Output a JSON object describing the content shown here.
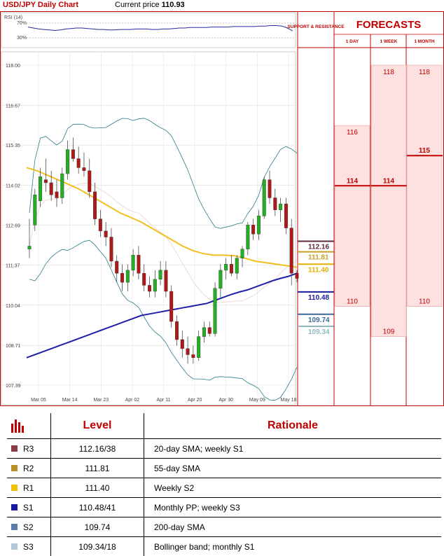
{
  "header": {
    "pair_title": "USD/JPY Daily Chart",
    "price_label": "Current price",
    "price_value": "110.93"
  },
  "chart_data": {
    "type": "candlestick",
    "title": "USD/JPY Daily Chart",
    "rsi": {
      "label": "RSI (14)",
      "levels": [
        "70%",
        "30%"
      ],
      "values": [
        62,
        60,
        58,
        57,
        56,
        55,
        56,
        58,
        59,
        60,
        60,
        59,
        58,
        57,
        57,
        56,
        56,
        57,
        57,
        57,
        58,
        58,
        58,
        57,
        57,
        58,
        58,
        59,
        60,
        60,
        61,
        61,
        61,
        61,
        62,
        62,
        62,
        62,
        63,
        63,
        63,
        63,
        63,
        64,
        64,
        65,
        65,
        64,
        60,
        54
      ]
    },
    "y_ticks": [
      "118.00",
      "116.67",
      "115.35",
      "114.02",
      "112.69",
      "111.37",
      "110.04",
      "108.71",
      "107.39"
    ],
    "ylim": [
      107.39,
      118.0
    ],
    "x_ticks": [
      "Mar 05",
      "Mar 14",
      "Mar 23",
      "Apr 02",
      "Apr 11",
      "Apr 20",
      "Apr 30",
      "May 09",
      "May 18"
    ],
    "candles": [
      {
        "o": 111.9,
        "h": 112.9,
        "l": 111.6,
        "c": 112.0
      },
      {
        "o": 112.7,
        "h": 113.9,
        "l": 112.5,
        "c": 113.7
      },
      {
        "o": 113.5,
        "h": 114.6,
        "l": 113.3,
        "c": 114.3
      },
      {
        "o": 114.2,
        "h": 114.9,
        "l": 113.8,
        "c": 114.1
      },
      {
        "o": 114.1,
        "h": 114.5,
        "l": 113.5,
        "c": 113.7
      },
      {
        "o": 113.8,
        "h": 114.2,
        "l": 113.3,
        "c": 113.6
      },
      {
        "o": 113.6,
        "h": 114.6,
        "l": 113.4,
        "c": 114.4
      },
      {
        "o": 114.4,
        "h": 115.5,
        "l": 114.2,
        "c": 115.2
      },
      {
        "o": 115.2,
        "h": 115.6,
        "l": 114.8,
        "c": 114.9
      },
      {
        "o": 114.9,
        "h": 115.3,
        "l": 114.4,
        "c": 114.6
      },
      {
        "o": 114.6,
        "h": 115.1,
        "l": 114.3,
        "c": 114.5
      },
      {
        "o": 114.5,
        "h": 114.9,
        "l": 113.6,
        "c": 113.8
      },
      {
        "o": 113.8,
        "h": 114.1,
        "l": 112.7,
        "c": 112.9
      },
      {
        "o": 112.9,
        "h": 113.2,
        "l": 112.3,
        "c": 112.5
      },
      {
        "o": 112.5,
        "h": 112.8,
        "l": 112.0,
        "c": 112.3
      },
      {
        "o": 112.3,
        "h": 112.6,
        "l": 111.3,
        "c": 111.5
      },
      {
        "o": 111.5,
        "h": 111.7,
        "l": 110.8,
        "c": 111.1
      },
      {
        "o": 111.1,
        "h": 111.4,
        "l": 110.5,
        "c": 110.8
      },
      {
        "o": 110.8,
        "h": 111.4,
        "l": 110.5,
        "c": 111.2
      },
      {
        "o": 111.2,
        "h": 111.9,
        "l": 111.0,
        "c": 111.7
      },
      {
        "o": 111.7,
        "h": 112.0,
        "l": 110.9,
        "c": 111.1
      },
      {
        "o": 111.1,
        "h": 111.4,
        "l": 110.5,
        "c": 110.7
      },
      {
        "o": 110.7,
        "h": 111.0,
        "l": 110.3,
        "c": 110.5
      },
      {
        "o": 110.5,
        "h": 111.2,
        "l": 110.3,
        "c": 110.9
      },
      {
        "o": 110.9,
        "h": 111.5,
        "l": 110.7,
        "c": 111.2
      },
      {
        "o": 111.2,
        "h": 111.5,
        "l": 110.3,
        "c": 110.5
      },
      {
        "o": 110.5,
        "h": 110.7,
        "l": 109.3,
        "c": 109.5
      },
      {
        "o": 109.5,
        "h": 109.7,
        "l": 108.7,
        "c": 108.9
      },
      {
        "o": 108.9,
        "h": 109.2,
        "l": 108.3,
        "c": 108.6
      },
      {
        "o": 108.6,
        "h": 109.0,
        "l": 108.1,
        "c": 108.4
      },
      {
        "o": 108.4,
        "h": 108.7,
        "l": 108.1,
        "c": 108.3
      },
      {
        "o": 108.3,
        "h": 109.2,
        "l": 108.2,
        "c": 109.0
      },
      {
        "o": 109.0,
        "h": 109.5,
        "l": 108.8,
        "c": 109.3
      },
      {
        "o": 109.3,
        "h": 109.5,
        "l": 109.0,
        "c": 109.1
      },
      {
        "o": 109.1,
        "h": 110.8,
        "l": 109.0,
        "c": 110.6
      },
      {
        "o": 110.6,
        "h": 111.4,
        "l": 110.3,
        "c": 111.2
      },
      {
        "o": 111.2,
        "h": 111.6,
        "l": 110.9,
        "c": 111.4
      },
      {
        "o": 111.4,
        "h": 111.7,
        "l": 111.0,
        "c": 111.1
      },
      {
        "o": 111.1,
        "h": 111.7,
        "l": 110.9,
        "c": 111.6
      },
      {
        "o": 111.6,
        "h": 112.0,
        "l": 111.3,
        "c": 111.9
      },
      {
        "o": 111.9,
        "h": 112.8,
        "l": 111.7,
        "c": 112.7
      },
      {
        "o": 112.7,
        "h": 112.9,
        "l": 112.2,
        "c": 112.4
      },
      {
        "o": 112.4,
        "h": 113.2,
        "l": 112.2,
        "c": 113.0
      },
      {
        "o": 113.0,
        "h": 114.3,
        "l": 112.9,
        "c": 114.2
      },
      {
        "o": 114.2,
        "h": 114.5,
        "l": 113.4,
        "c": 113.6
      },
      {
        "o": 113.6,
        "h": 113.9,
        "l": 113.0,
        "c": 113.2
      },
      {
        "o": 113.2,
        "h": 113.6,
        "l": 112.8,
        "c": 113.4
      },
      {
        "o": 113.4,
        "h": 113.6,
        "l": 112.4,
        "c": 112.6
      },
      {
        "o": 112.6,
        "h": 112.9,
        "l": 110.7,
        "c": 111.1
      },
      {
        "o": 111.1,
        "h": 111.2,
        "l": 110.8,
        "c": 110.93
      }
    ],
    "sma200": [
      108.3,
      108.4,
      108.5,
      108.6,
      108.7,
      108.8,
      108.9,
      109.0,
      109.1,
      109.2,
      109.3,
      109.4,
      109.5,
      109.6,
      109.7,
      109.75,
      109.8,
      109.85,
      109.9,
      109.95,
      110.0,
      110.05,
      110.1,
      110.2,
      110.3,
      110.4,
      110.48,
      110.55,
      110.65,
      110.75,
      110.85,
      110.93,
      111.0,
      111.1
    ],
    "sma55": [
      114.6,
      114.5,
      114.35,
      114.2,
      114.05,
      113.9,
      113.7,
      113.5,
      113.3,
      113.1,
      112.95,
      112.8,
      112.6,
      112.4,
      112.2,
      112.0,
      111.85,
      111.75,
      111.7,
      111.7,
      111.68,
      111.6,
      111.5,
      111.45,
      111.4,
      111.35,
      111.3
    ],
    "forecast": {
      "columns": [
        "1 DAY",
        "1 WEEK",
        "1 MONTH"
      ],
      "header": "FORECASTS",
      "support_resistance_label": "SUPPORT & RESISTANCE",
      "one_day": {
        "high": "116",
        "mid": "114",
        "low": "110"
      },
      "one_week": {
        "high": "118",
        "mid": "114",
        "low": "109"
      },
      "one_month": {
        "high": "118",
        "mid": "115",
        "low": "110"
      }
    },
    "levels": [
      {
        "value": "112.16",
        "color": "#5c2a3a"
      },
      {
        "value": "111.81",
        "color": "#c8a020"
      },
      {
        "value": "111.40",
        "color": "#e0b000"
      },
      {
        "value": "110.48",
        "color": "#1a1aa0"
      },
      {
        "value": "109.74",
        "color": "#3a6a9a"
      },
      {
        "value": "109.34",
        "color": "#8fb8c0"
      }
    ]
  },
  "table": {
    "headers": {
      "level": "Level",
      "rationale": "Rationale"
    },
    "rows": [
      {
        "code": "R3",
        "color": "#8b3a4a",
        "level": "112.16/38",
        "rationale": "20-day SMA; weekly S1"
      },
      {
        "code": "R2",
        "color": "#b8902a",
        "level": "111.81",
        "rationale": "55-day SMA"
      },
      {
        "code": "R1",
        "color": "#f0c000",
        "level": "111.40",
        "rationale": "Weekly S2"
      },
      {
        "code": "S1",
        "color": "#1a1aa0",
        "level": "110.48/41",
        "rationale": "Monthly PP; weekly S3"
      },
      {
        "code": "S2",
        "color": "#5a7ea8",
        "level": "109.74",
        "rationale": "200-day SMA"
      },
      {
        "code": "S3",
        "color": "#b0c8d8",
        "level": "109.34/18",
        "rationale": "Bollinger band; monthly S1"
      }
    ]
  }
}
